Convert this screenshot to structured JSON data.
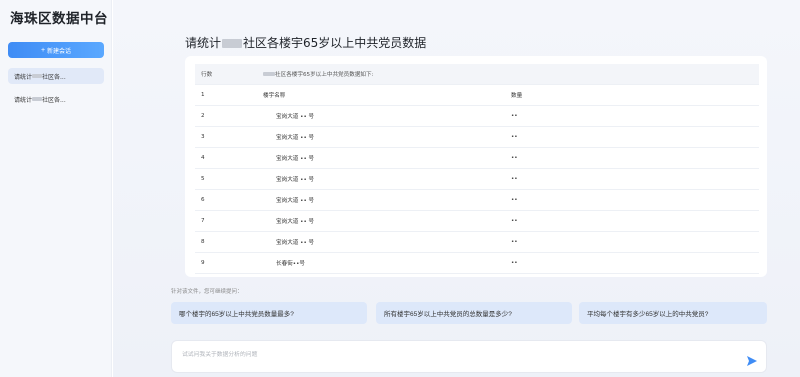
{
  "sidebar": {
    "app_title": "海珠区数据中台",
    "new_chat_label": "新建会话",
    "history": [
      {
        "prefix": "请统计",
        "suffix": "社区各..."
      },
      {
        "prefix": "请统计",
        "suffix": "社区各..."
      }
    ]
  },
  "main": {
    "title_prefix": "请统计",
    "title_suffix": "社区各楼宇65岁以上中共党员数据",
    "table": {
      "header_index": "行数",
      "header_text_suffix": "社区各楼宇65岁以上中共党员数据如下:",
      "rows": [
        {
          "idx": "1",
          "name": "楼宇名称",
          "count": "数量"
        },
        {
          "idx": "2",
          "name": "宝岗大道 •• 号",
          "count": "••"
        },
        {
          "idx": "3",
          "name": "宝岗大道 •• 号",
          "count": "••"
        },
        {
          "idx": "4",
          "name": "宝岗大道 •• 号",
          "count": "••"
        },
        {
          "idx": "5",
          "name": "宝岗大道 •• 号",
          "count": "••"
        },
        {
          "idx": "6",
          "name": "宝岗大道 •• 号",
          "count": "••"
        },
        {
          "idx": "7",
          "name": "宝岗大道 •• 号",
          "count": "••"
        },
        {
          "idx": "8",
          "name": "宝岗大道 •• 号",
          "count": "••"
        },
        {
          "idx": "9",
          "name": "长春街••号",
          "count": "••"
        }
      ]
    },
    "suggest_hint": "针对该文件，您可继续提问：",
    "suggestions": [
      "哪个楼宇的65岁以上中共党员数量最多?",
      "所有楼宇65岁以上中共党员的总数量是多少?",
      "平均每个楼宇有多少65岁以上的中共党员?"
    ],
    "input_placeholder": "试试问我关于数据分析的问题",
    "send_icon": "send-arrow-icon",
    "accent_color": "#3f8cf5"
  }
}
